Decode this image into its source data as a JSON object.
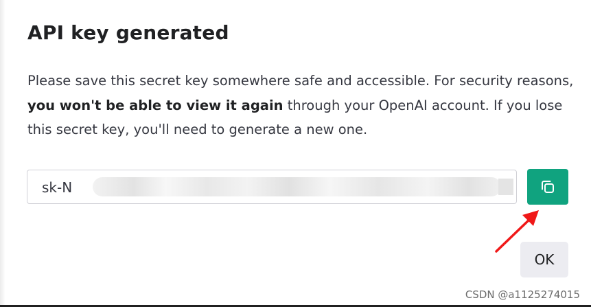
{
  "dialog": {
    "title": "API key generated",
    "description": {
      "part1": "Please save this secret key somewhere safe and accessible. For security reasons, ",
      "bold": "you won't be able to view it again",
      "part2": " through your OpenAI account. If you lose this secret key, you'll need to generate a new one."
    },
    "key_field": {
      "visible_value": "sk-N"
    },
    "copy_button": {
      "icon": "copy-icon",
      "color": "#10a37f"
    },
    "annotation": {
      "icon": "red-arrow-icon",
      "color": "#f01818"
    },
    "ok_label": "OK"
  },
  "watermark": "CSDN @a1125274015"
}
